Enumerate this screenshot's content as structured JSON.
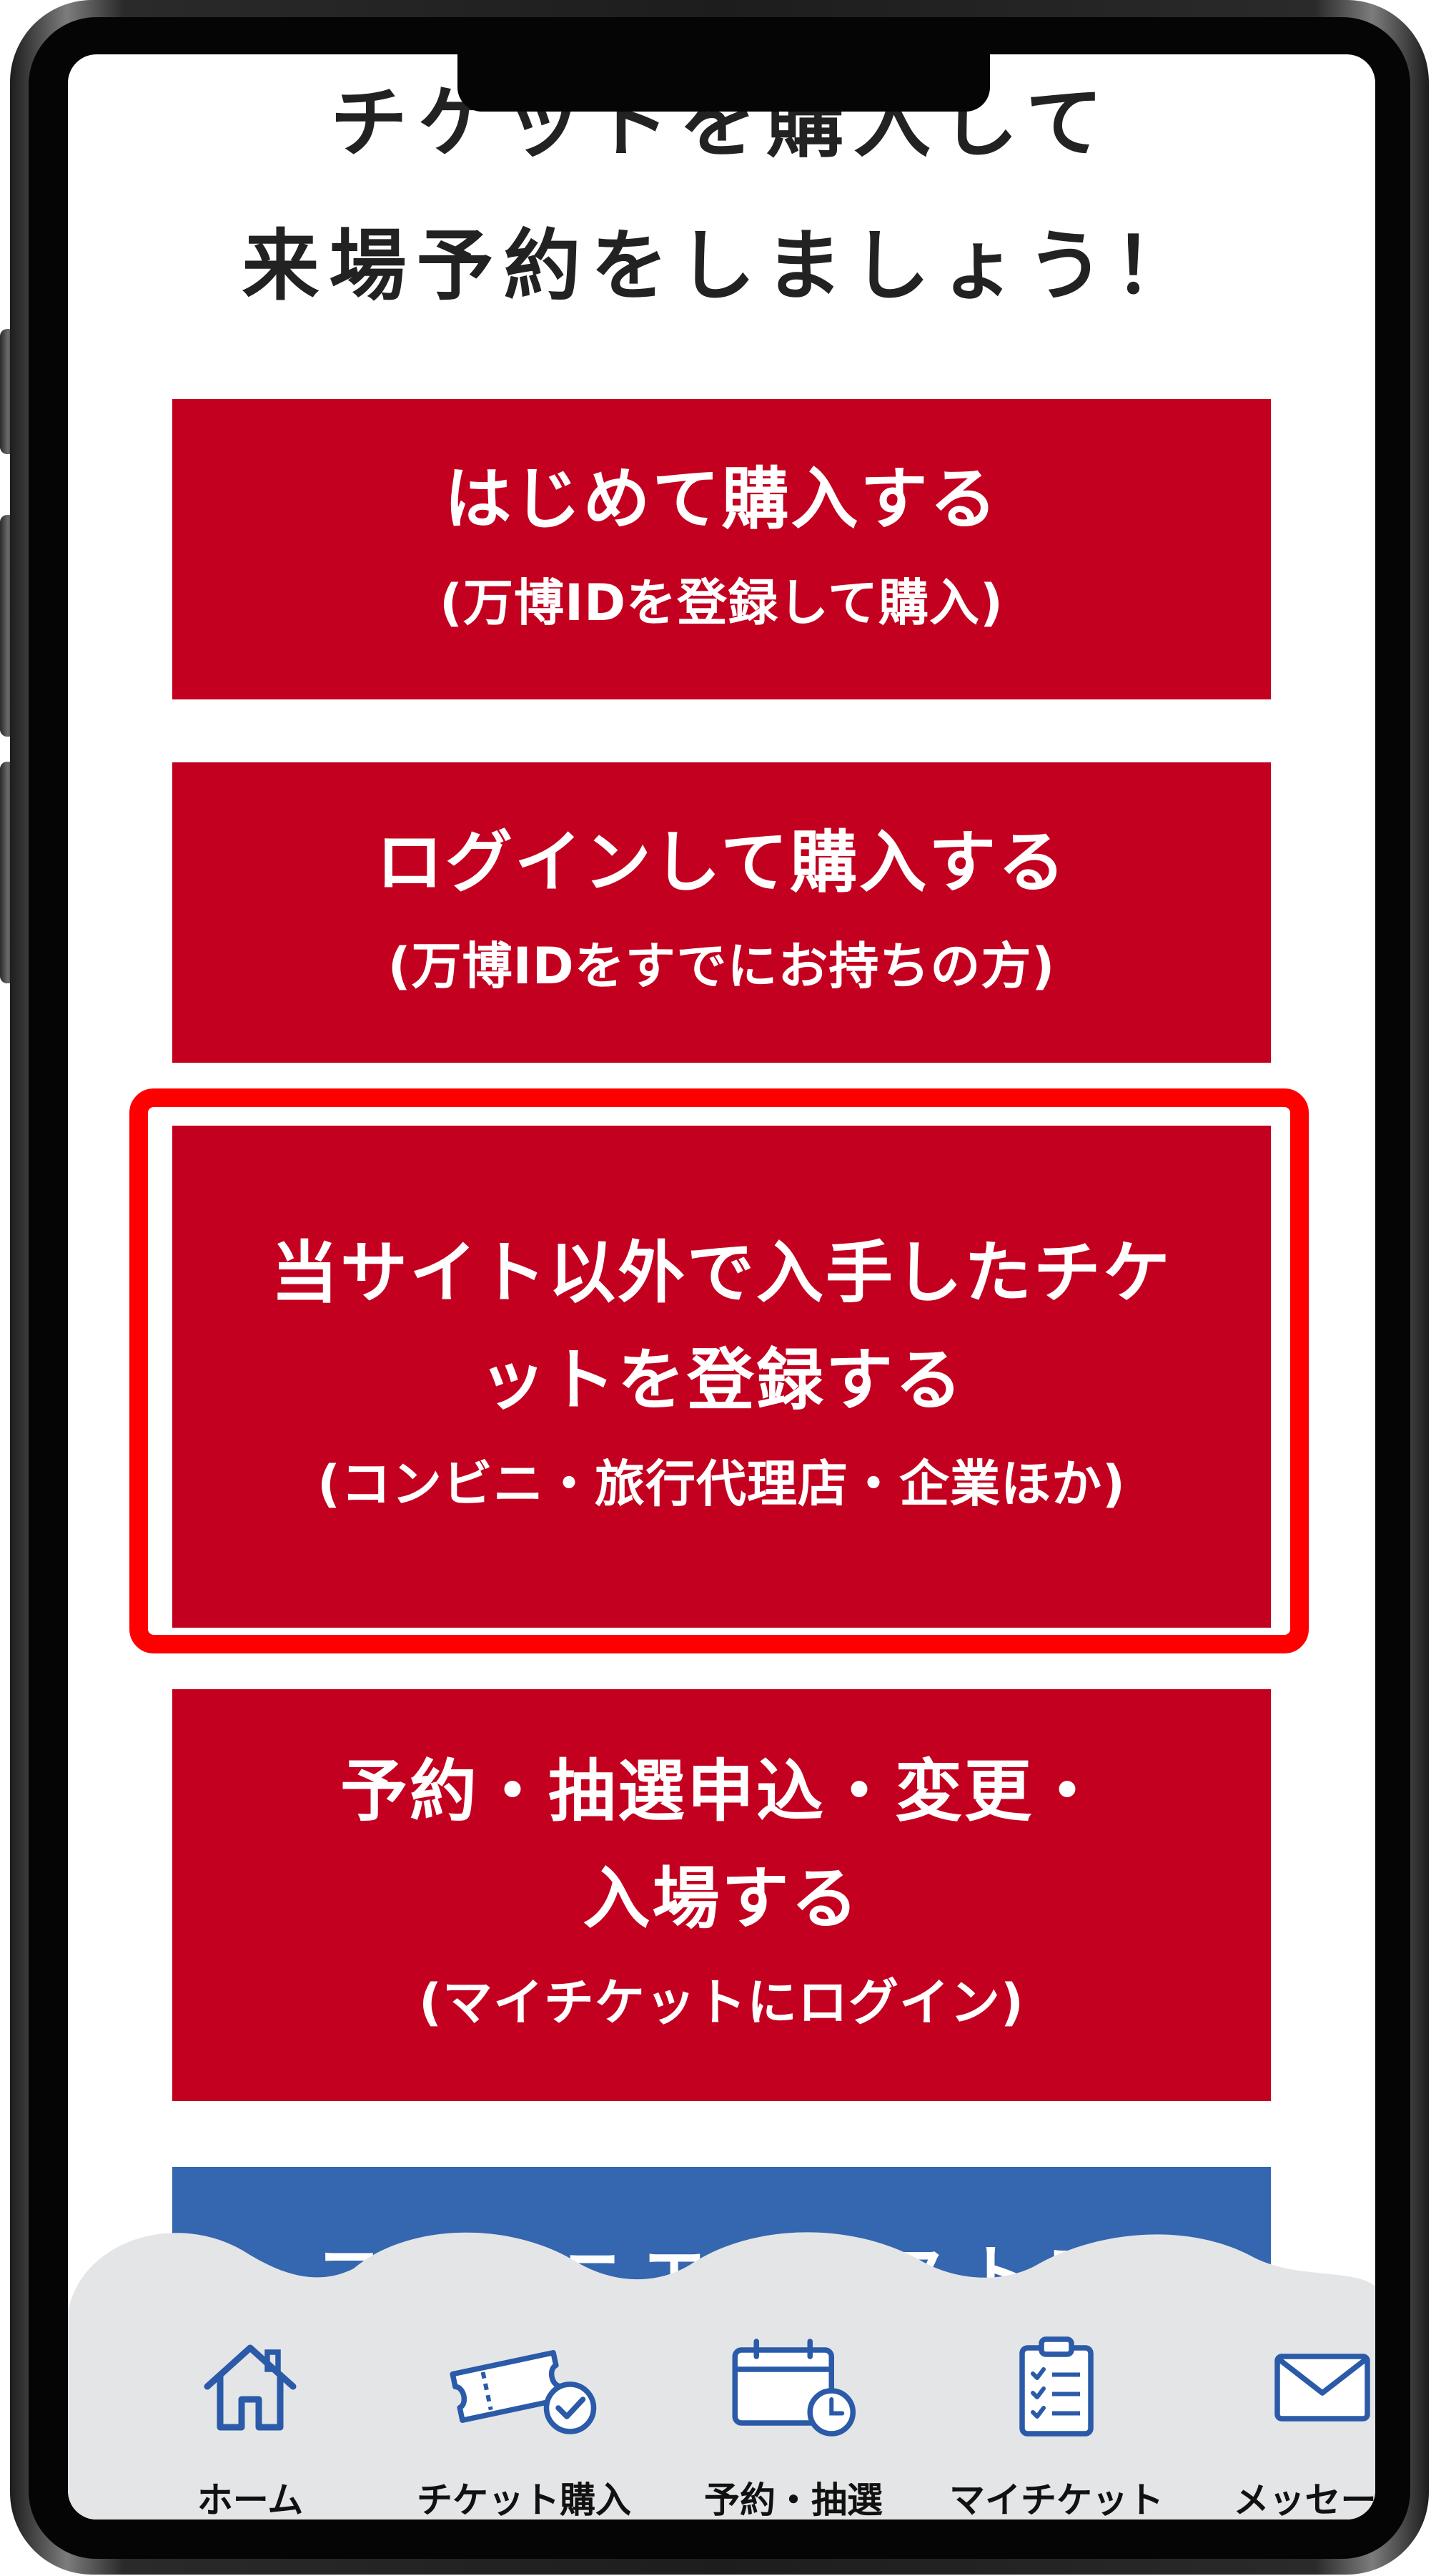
{
  "heading": {
    "line1": "チケットを購入して",
    "line2": "来場予約をしましょう！"
  },
  "buttons": [
    {
      "main": "はじめて購入する",
      "sub": "(万博IDを登録して購入)"
    },
    {
      "main": "ログインして購入する",
      "sub": "(万博IDをすでにお持ちの方)"
    },
    {
      "main": "当サイト以外で入手したチケットを登録する",
      "sub": "(コンビニ・旅行代理店・企業ほか)"
    },
    {
      "main": "予約・抽選申込・変更・入場する",
      "sub": "(マイチケットにログイン)"
    },
    {
      "main": "コンビニエンスストア"
    }
  ],
  "nav": {
    "items": [
      {
        "label": "ホーム",
        "icon": "home-icon"
      },
      {
        "label": "チケット購入",
        "icon": "ticket-check-icon"
      },
      {
        "label": "予約・抽選",
        "icon": "calendar-clock-icon"
      },
      {
        "label": "マイチケット",
        "icon": "clipboard-list-icon"
      },
      {
        "label": "メッセージ",
        "icon": "mail-icon"
      }
    ]
  },
  "colors": {
    "primary_red": "#c3001f",
    "secondary_blue": "#3566b0",
    "highlight": "#ff0000",
    "icon_blue": "#2a5aa8",
    "nav_background": "#e4e5e7"
  }
}
